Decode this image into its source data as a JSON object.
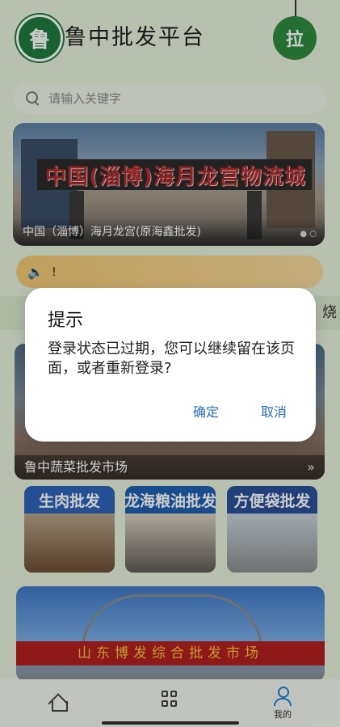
{
  "header": {
    "logo_char": "鲁",
    "app_title": "鲁中批发平台",
    "fab_label": "拉"
  },
  "search": {
    "placeholder": "请输入关键字"
  },
  "banner": {
    "sign_text": "中国(淄博)海月龙宫物流城",
    "caption": "中国（淄博）海月龙宫(原海鑫批发)"
  },
  "notice": {
    "text": "!"
  },
  "strip": {
    "text": "烧"
  },
  "big_market": {
    "caption": "鲁中蔬菜批发市场"
  },
  "thumbs": [
    {
      "sign": "生肉批发",
      "color": "#2f63b8"
    },
    {
      "sign": "龙海粮油批发",
      "color": "#1f5fb0"
    },
    {
      "sign": "方便袋批发",
      "color": "#2a4f9a"
    }
  ],
  "market_photo": {
    "sign": "山东博发综合批发市场"
  },
  "tabbar": {
    "mine_label": "我的"
  },
  "dialog": {
    "title": "提示",
    "message": "登录状态已过期，您可以继续留在该页面，或者重新登录?",
    "confirm_label": "确定",
    "cancel_label": "取消"
  },
  "colors": {
    "brand_green": "#2e8b3e",
    "dialog_button": "#2a6db7",
    "notice_bg": "#f2c774"
  }
}
